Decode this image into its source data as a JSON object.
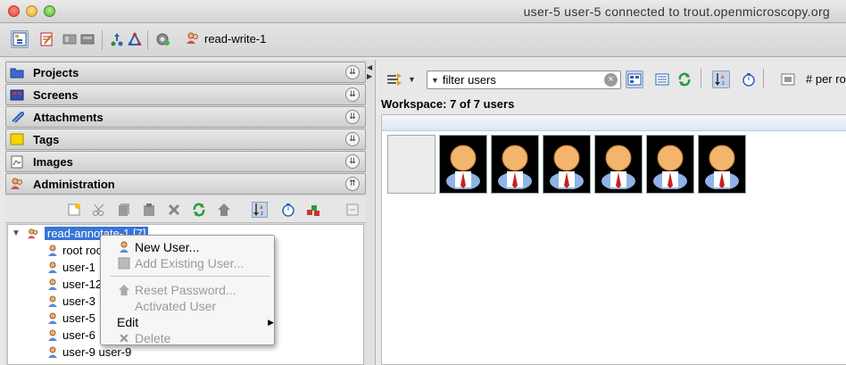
{
  "window": {
    "title": "user-5 user-5 connected to trout.openmicroscopy.org"
  },
  "toolbar": {
    "group_label": "read-write-1"
  },
  "accordion": [
    {
      "label": "Projects",
      "icon": "folder-icon"
    },
    {
      "label": "Screens",
      "icon": "screen-icon"
    },
    {
      "label": "Attachments",
      "icon": "paperclip-icon"
    },
    {
      "label": "Tags",
      "icon": "tag-icon"
    },
    {
      "label": "Images",
      "icon": "image-icon"
    },
    {
      "label": "Administration",
      "icon": "admin-icon"
    }
  ],
  "tree": {
    "group_label": "read-annotate-1 [7]",
    "users": [
      "root roo",
      "user-1",
      "user-12",
      "user-3",
      "user-5",
      "user-6",
      "user-9 user-9"
    ]
  },
  "context_menu": {
    "new_user": "New User...",
    "add_existing": "Add Existing User...",
    "reset_password": "Reset Password...",
    "activated_user": "Activated User",
    "edit": "Edit",
    "delete": "Delete"
  },
  "right": {
    "filter_placeholder": "filter users",
    "per_row_label": "# per ro",
    "workspace_label": "Workspace: 7 of 7 users"
  },
  "colors": {
    "selection": "#3875d7",
    "accent": "#c8d4e6"
  }
}
